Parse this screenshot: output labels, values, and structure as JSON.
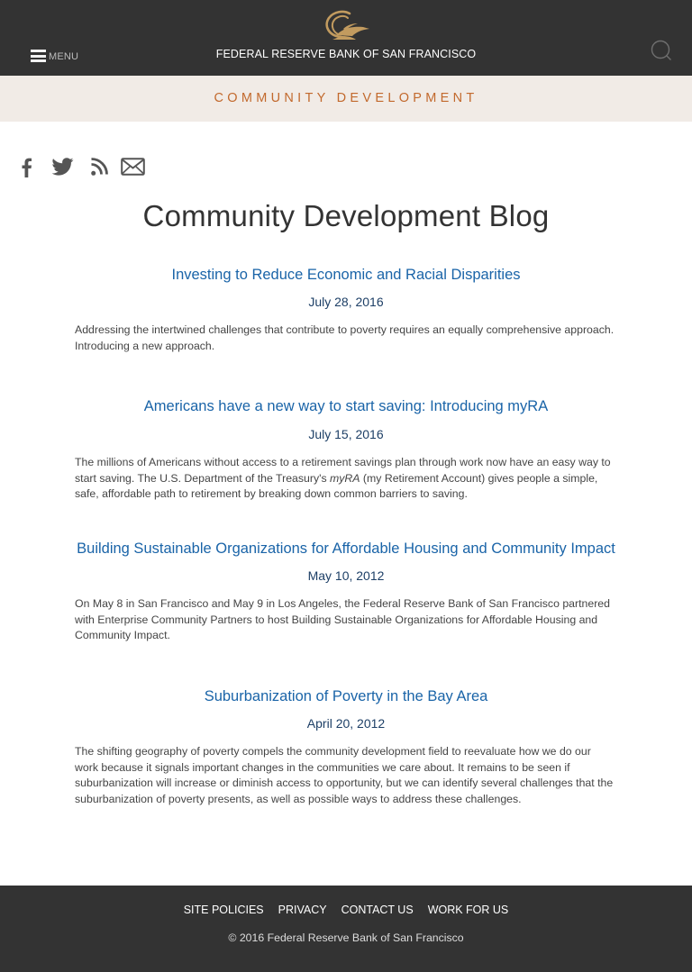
{
  "header": {
    "menu_label": "MENU",
    "bank_name": "FEDERAL RESERVE BANK OF SAN FRANCISCO",
    "logo_color": "#c29b5f",
    "icons": [
      "menu-icon",
      "eagle-logo-icon",
      "search-icon"
    ]
  },
  "section": {
    "title": "COMMUNITY DEVELOPMENT",
    "accent_color": "#c2692d"
  },
  "social": [
    "facebook-icon",
    "twitter-icon",
    "rss-icon",
    "email-icon"
  ],
  "page": {
    "title": "Community Development Blog"
  },
  "posts": [
    {
      "title": "Investing to Reduce Economic and Racial Disparities",
      "date": "July 28, 2016",
      "excerpt": "Addressing the intertwined challenges that contribute to poverty requires an equally comprehensive approach. Introducing a new approach."
    },
    {
      "title": "Americans have a new way to start saving: Introducing myRA",
      "date": "July 15, 2016",
      "excerpt_before": "The millions of Americans without access to a retirement savings plan through work now have an easy way to start saving. The U.S. Department of the Treasury's ",
      "excerpt_em": "myRA",
      "excerpt_after": " (my Retirement Account) gives people a simple, safe, affordable path to retirement by breaking down common barriers to saving."
    },
    {
      "title": "Building Sustainable Organizations for Affordable Housing and Community Impact",
      "date": "May 10, 2012",
      "excerpt": "On May 8 in San Francisco and May 9 in Los Angeles, the Federal Reserve Bank of San Francisco partnered with Enterprise Community Partners to host Building Sustainable Organizations for Affordable Housing and Community Impact."
    },
    {
      "title": "Suburbanization of Poverty in the Bay Area",
      "date": "April 20, 2012",
      "excerpt": "The shifting geography of poverty compels the community development field to reevaluate how we do our work because it signals important changes in the communities we care about. It remains to be seen if suburbanization will increase or diminish access to opportunity, but we can identify several challenges that the suburbanization of poverty presents, as well as possible ways to address these challenges."
    }
  ],
  "footer": {
    "links": [
      "SITE POLICIES",
      "PRIVACY",
      "CONTACT US",
      "WORK FOR US"
    ],
    "copyright": "© 2016 Federal Reserve Bank of San Francisco"
  },
  "colors": {
    "header_bg": "#333333",
    "band_bg": "#f1ebe6",
    "link_blue": "#1a64a8",
    "date_navy": "#1d3f66"
  }
}
